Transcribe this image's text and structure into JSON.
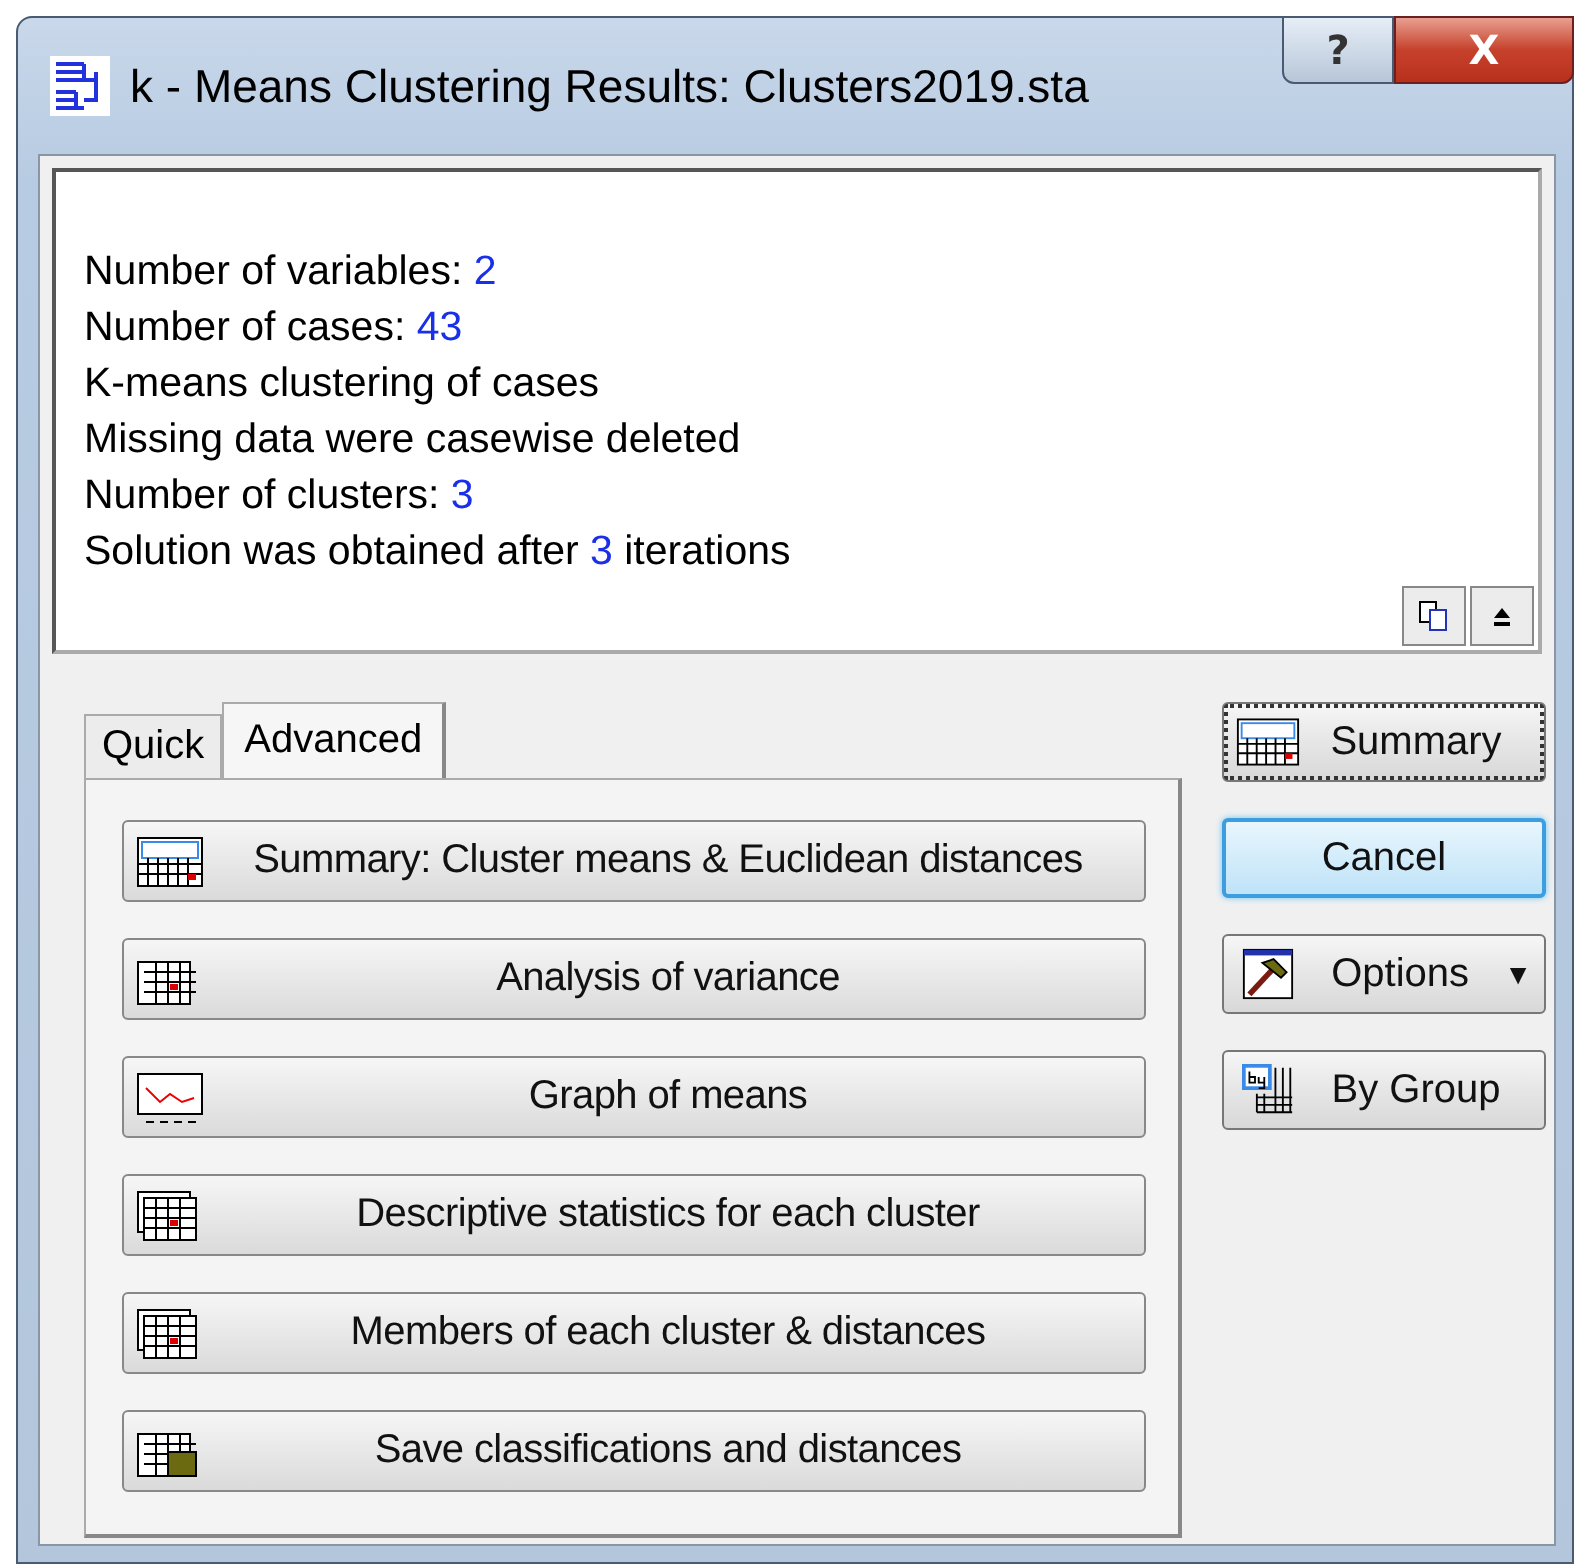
{
  "window": {
    "title": "k - Means Clustering Results: Clusters2019.sta",
    "help_button": "?",
    "close_button": "X"
  },
  "results": [
    [
      {
        "text": "Number of variables: ",
        "highlight": false
      },
      {
        "text": "2",
        "highlight": true
      }
    ],
    [
      {
        "text": "Number of cases: ",
        "highlight": false
      },
      {
        "text": "43",
        "highlight": true
      }
    ],
    [
      {
        "text": "K-means clustering of cases",
        "highlight": false
      }
    ],
    [
      {
        "text": "Missing data were casewise deleted",
        "highlight": false
      }
    ],
    [
      {
        "text": "Number of clusters: ",
        "highlight": false
      },
      {
        "text": "3",
        "highlight": true
      }
    ],
    [
      {
        "text": "Solution was obtained after ",
        "highlight": false
      },
      {
        "text": "3",
        "highlight": true
      },
      {
        "text": " iterations",
        "highlight": false
      }
    ]
  ],
  "tabs": [
    {
      "label": "Quick",
      "selected": false
    },
    {
      "label": "Advanced",
      "selected": true
    }
  ],
  "actions": [
    {
      "label": "Summary: Cluster means & Euclidean distances"
    },
    {
      "label": "Analysis of variance"
    },
    {
      "label": "Graph of means"
    },
    {
      "label": "Descriptive statistics for each cluster"
    },
    {
      "label": "Members of each cluster & distances"
    },
    {
      "label": "Save classifications and distances"
    }
  ],
  "side_buttons": [
    {
      "label": "Summary",
      "focused": true
    },
    {
      "label": "Cancel",
      "focused": false,
      "default": true
    },
    {
      "label": "Options",
      "dropdown": "▼",
      "focused": false
    },
    {
      "label": "By Group",
      "focused": false
    }
  ]
}
